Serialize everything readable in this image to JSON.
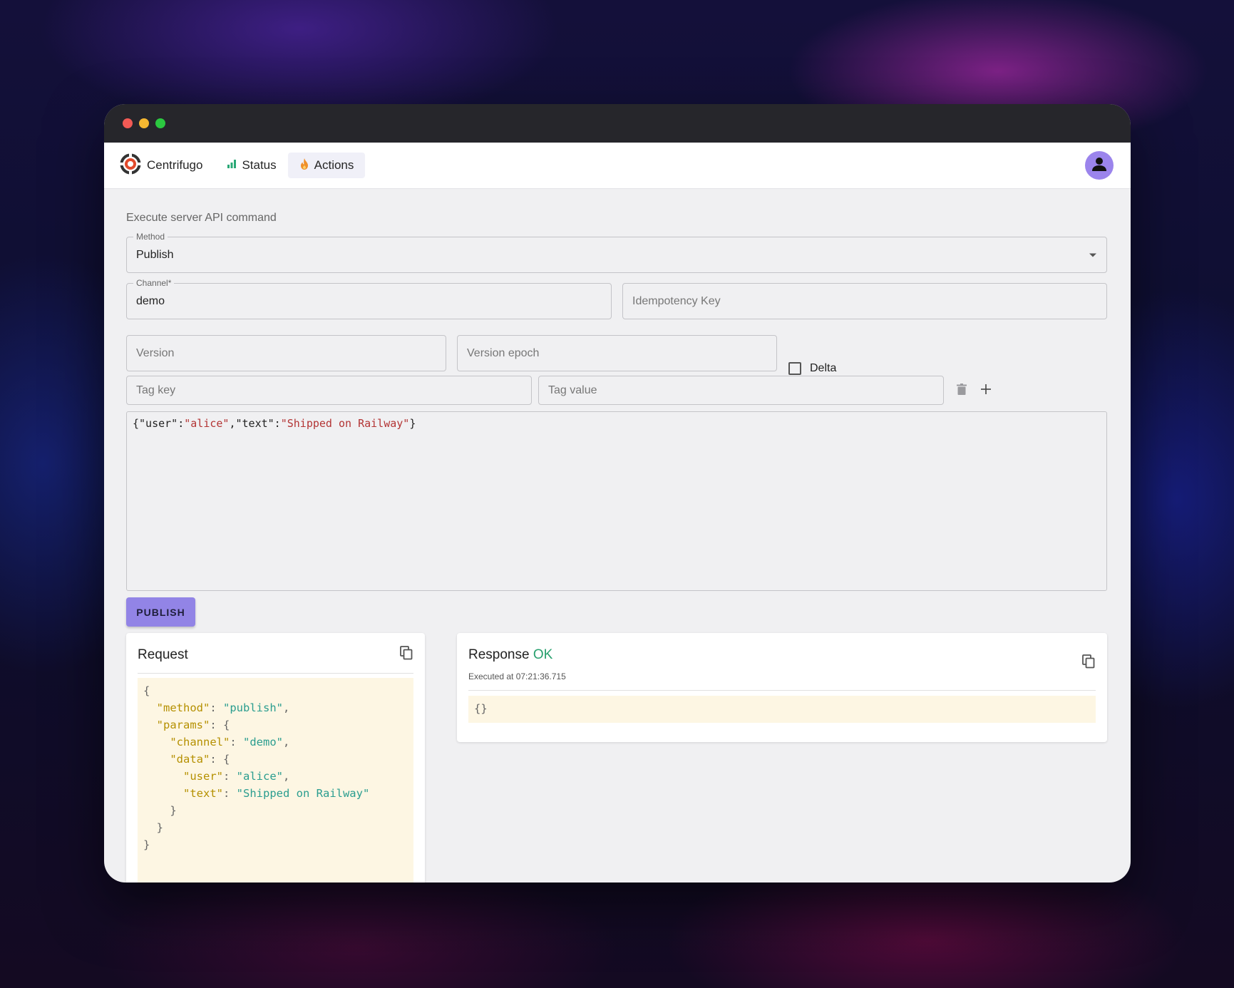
{
  "app": {
    "brand": "Centrifugo",
    "nav": [
      {
        "label": "Status",
        "icon": "bar-chart-icon"
      },
      {
        "label": "Actions",
        "icon": "fire-icon"
      }
    ],
    "accent": "#9284e6"
  },
  "form": {
    "heading": "Execute server API command",
    "method": {
      "label": "Method",
      "value": "Publish"
    },
    "channel": {
      "label": "Channel*",
      "value": "demo"
    },
    "idempotency": {
      "placeholder": "Idempotency Key"
    },
    "version": {
      "placeholder": "Version"
    },
    "version_epoch": {
      "placeholder": "Version epoch"
    },
    "delta": {
      "label": "Delta",
      "checked": false
    },
    "tag_key": {
      "placeholder": "Tag key"
    },
    "tag_value": {
      "placeholder": "Tag value"
    },
    "data_editor": {
      "p1": "{\"user\":",
      "s1": "\"alice\"",
      "p2": ",\"text\":",
      "s2": "\"Shipped on Railway\"",
      "p3": "}"
    },
    "submit_label": "PUBLISH"
  },
  "request": {
    "title": "Request",
    "json": {
      "open": "{",
      "method_key": "\"method\"",
      "method_val": "\"publish\"",
      "params_key": "\"params\"",
      "channel_key": "\"channel\"",
      "channel_val": "\"demo\"",
      "data_key": "\"data\"",
      "user_key": "\"user\"",
      "user_val": "\"alice\"",
      "text_key": "\"text\"",
      "text_val": "\"Shipped on Railway\""
    }
  },
  "response": {
    "title": "Response",
    "status": "OK",
    "executed_at": "Executed at 07:21:36.715",
    "body": "{}"
  }
}
